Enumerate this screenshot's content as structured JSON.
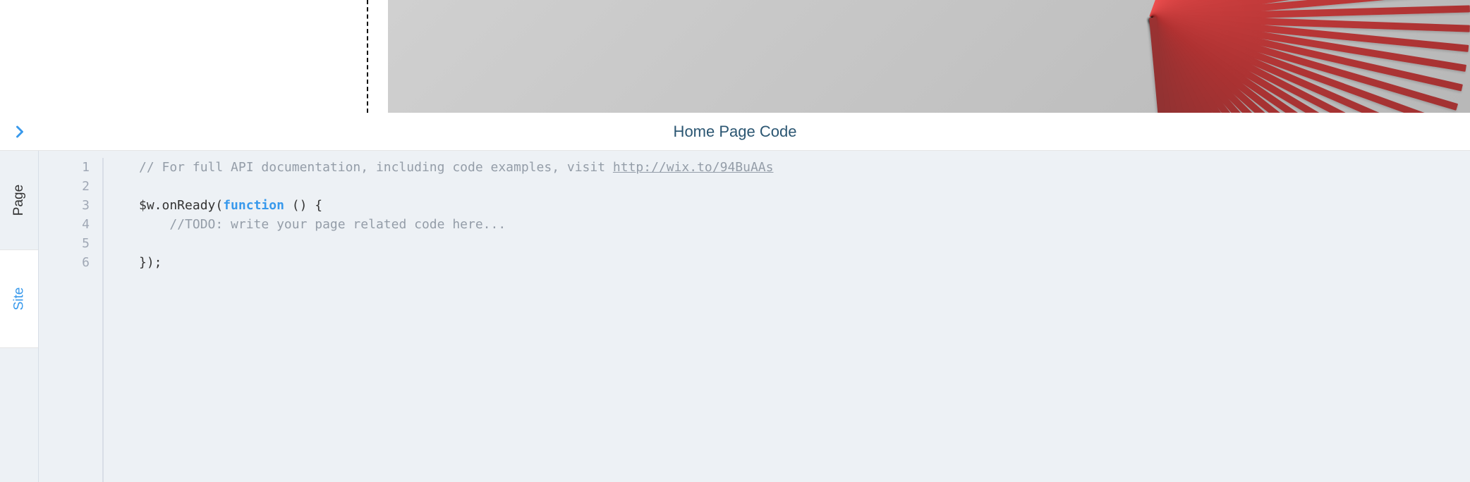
{
  "preview": {
    "image_description": "folded paper fan, red"
  },
  "panel": {
    "title": "Home Page Code"
  },
  "tabs": {
    "active": "Page",
    "page_label": "Page",
    "site_label": "Site"
  },
  "code": {
    "line_numbers": [
      1,
      2,
      3,
      4,
      5,
      6
    ],
    "lines": {
      "l1_comment_prefix": "// For full API documentation, including code examples, visit ",
      "l1_link": "http://wix.to/94BuAAs",
      "l3_prefix": "$w.onReady(",
      "l3_keyword": "function",
      "l3_suffix": " () {",
      "l4_comment": "    //TODO: write your page related code here...",
      "l6": "});"
    }
  }
}
